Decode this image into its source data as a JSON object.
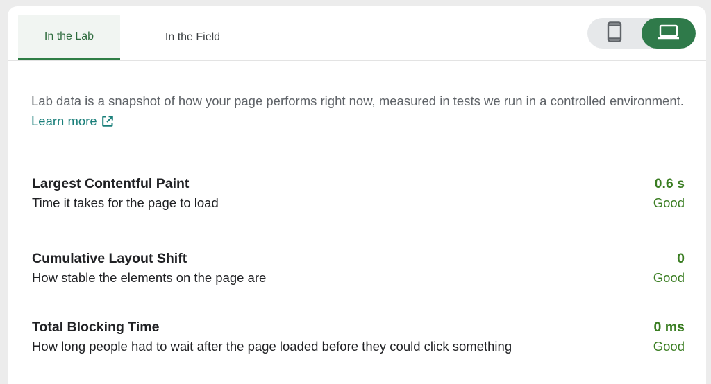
{
  "tabs": [
    {
      "label": "In the Lab",
      "active": true
    },
    {
      "label": "In the Field",
      "active": false
    }
  ],
  "device_toggle": {
    "mobile_icon": "smartphone-icon",
    "desktop_icon": "laptop-icon",
    "selected": "desktop",
    "accent_color": "#2f7a4a"
  },
  "description": {
    "text": "Lab data is a snapshot of how your page performs right now, measured in tests we run in a controlled environment.",
    "link_label": "Learn more",
    "link_icon": "open-in-new-icon"
  },
  "metrics": [
    {
      "title": "Largest Contentful Paint",
      "subtitle": "Time it takes for the page to load",
      "value": "0.6 s",
      "rating": "Good"
    },
    {
      "title": "Cumulative Layout Shift",
      "subtitle": "How stable the elements on the page are",
      "value": "0",
      "rating": "Good"
    },
    {
      "title": "Total Blocking Time",
      "subtitle": "How long people had to wait after the page loaded before they could click something",
      "value": "0 ms",
      "rating": "Good"
    }
  ],
  "colors": {
    "good": "#3a7d22",
    "link": "#1a7f7a",
    "active_tab_text": "#2e6b3e"
  }
}
